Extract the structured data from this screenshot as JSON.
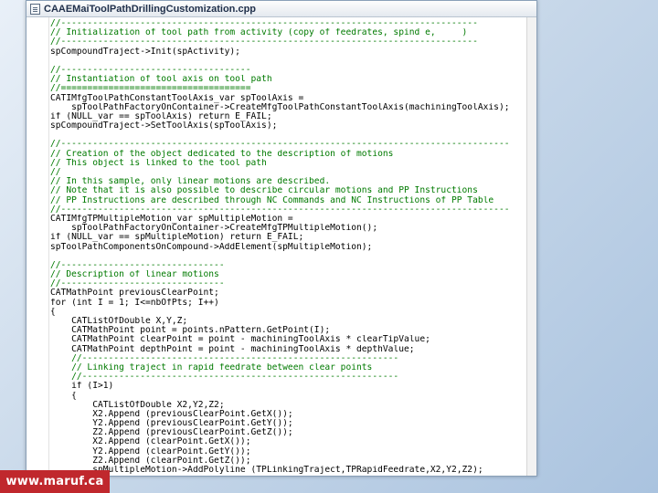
{
  "window": {
    "title": "CAAEMaiToolPathDrillingCustomization.cpp"
  },
  "code_lines": [
    {
      "kind": "comment",
      "text": "//-------------------------------------------------------------------------------"
    },
    {
      "kind": "comment",
      "text": "// Initialization of tool path from activity (copy of feedrates, spind e,     )"
    },
    {
      "kind": "comment",
      "text": "//-------------------------------------------------------------------------------"
    },
    {
      "kind": "plain",
      "text": "spCompoundTraject->Init(spActivity);"
    },
    {
      "kind": "plain",
      "text": ""
    },
    {
      "kind": "comment",
      "text": "//------------------------------------"
    },
    {
      "kind": "comment",
      "text": "// Instantiation of tool axis on tool path"
    },
    {
      "kind": "comment",
      "text": "//===================================="
    },
    {
      "kind": "plain",
      "text": "CATIMfgToolPathConstantToolAxis_var spToolAxis ="
    },
    {
      "kind": "plain",
      "text": "    spToolPathFactoryOnContainer->CreateMfgToolPathConstantToolAxis(machiningToolAxis);"
    },
    {
      "kind": "plain",
      "text": "if (NULL_var == spToolAxis) return E_FAIL;"
    },
    {
      "kind": "plain",
      "text": "spCompoundTraject->SetToolAxis(spToolAxis);"
    },
    {
      "kind": "plain",
      "text": ""
    },
    {
      "kind": "comment",
      "text": "//-------------------------------------------------------------------------------------"
    },
    {
      "kind": "comment",
      "text": "// Creation of the object dedicated to the description of motions"
    },
    {
      "kind": "comment",
      "text": "// This object is linked to the tool path"
    },
    {
      "kind": "comment",
      "text": "//"
    },
    {
      "kind": "comment",
      "text": "// In this sample, only linear motions are described."
    },
    {
      "kind": "comment",
      "text": "// Note that it is also possible to describe circular motions and PP Instructions"
    },
    {
      "kind": "comment",
      "text": "// PP Instructions are described through NC Commands and NC Instructions of PP Table"
    },
    {
      "kind": "comment",
      "text": "//-------------------------------------------------------------------------------------"
    },
    {
      "kind": "plain",
      "text": "CATIMfgTPMultipleMotion_var spMultipleMotion ="
    },
    {
      "kind": "plain",
      "text": "    spToolPathFactoryOnContainer->CreateMfgTPMultipleMotion();"
    },
    {
      "kind": "plain",
      "text": "if (NULL_var == spMultipleMotion) return E_FAIL;"
    },
    {
      "kind": "plain",
      "text": "spToolPathComponentsOnCompound->AddElement(spMultipleMotion);"
    },
    {
      "kind": "plain",
      "text": ""
    },
    {
      "kind": "comment",
      "text": "//-------------------------------"
    },
    {
      "kind": "comment",
      "text": "// Description of linear motions"
    },
    {
      "kind": "comment",
      "text": "//-------------------------------"
    },
    {
      "kind": "plain",
      "text": "CATMathPoint previousClearPoint;"
    },
    {
      "kind": "plain",
      "text": "for (int I = 1; I<=nbOfPts; I++)"
    },
    {
      "kind": "plain",
      "text": "{"
    },
    {
      "kind": "plain",
      "text": "    CATListOfDouble X,Y,Z;"
    },
    {
      "kind": "plain",
      "text": "    CATMathPoint point = points.nPattern.GetPoint(I);"
    },
    {
      "kind": "plain",
      "text": "    CATMathPoint clearPoint = point - machiningToolAxis * clearTipValue;"
    },
    {
      "kind": "plain",
      "text": "    CATMathPoint depthPoint = point - machiningToolAxis * depthValue;"
    },
    {
      "kind": "comment",
      "text": "    //------------------------------------------------------------"
    },
    {
      "kind": "comment",
      "text": "    // Linking traject in rapid feedrate between clear points"
    },
    {
      "kind": "comment",
      "text": "    //------------------------------------------------------------"
    },
    {
      "kind": "plain",
      "text": "    if (I>1)"
    },
    {
      "kind": "plain",
      "text": "    {"
    },
    {
      "kind": "plain",
      "text": "        CATListOfDouble X2,Y2,Z2;"
    },
    {
      "kind": "plain",
      "text": "        X2.Append (previousClearPoint.GetX());"
    },
    {
      "kind": "plain",
      "text": "        Y2.Append (previousClearPoint.GetY());"
    },
    {
      "kind": "plain",
      "text": "        Z2.Append (previousClearPoint.GetZ());"
    },
    {
      "kind": "plain",
      "text": "        X2.Append (clearPoint.GetX());"
    },
    {
      "kind": "plain",
      "text": "        Y2.Append (clearPoint.GetY());"
    },
    {
      "kind": "plain",
      "text": "        Z2.Append (clearPoint.GetZ());"
    },
    {
      "kind": "plain",
      "text": "        spMultipleMotion->AddPolyline (TPLinkingTraject,TPRapidFeedrate,X2,Y2,Z2);"
    },
    {
      "kind": "plain",
      "text": "    }"
    }
  ],
  "watermark": {
    "text": "www.maruf.ca",
    "color": "#c0282d"
  },
  "colors": {
    "comment": "#007a00",
    "code": "#000000",
    "background": "#ffffff"
  }
}
